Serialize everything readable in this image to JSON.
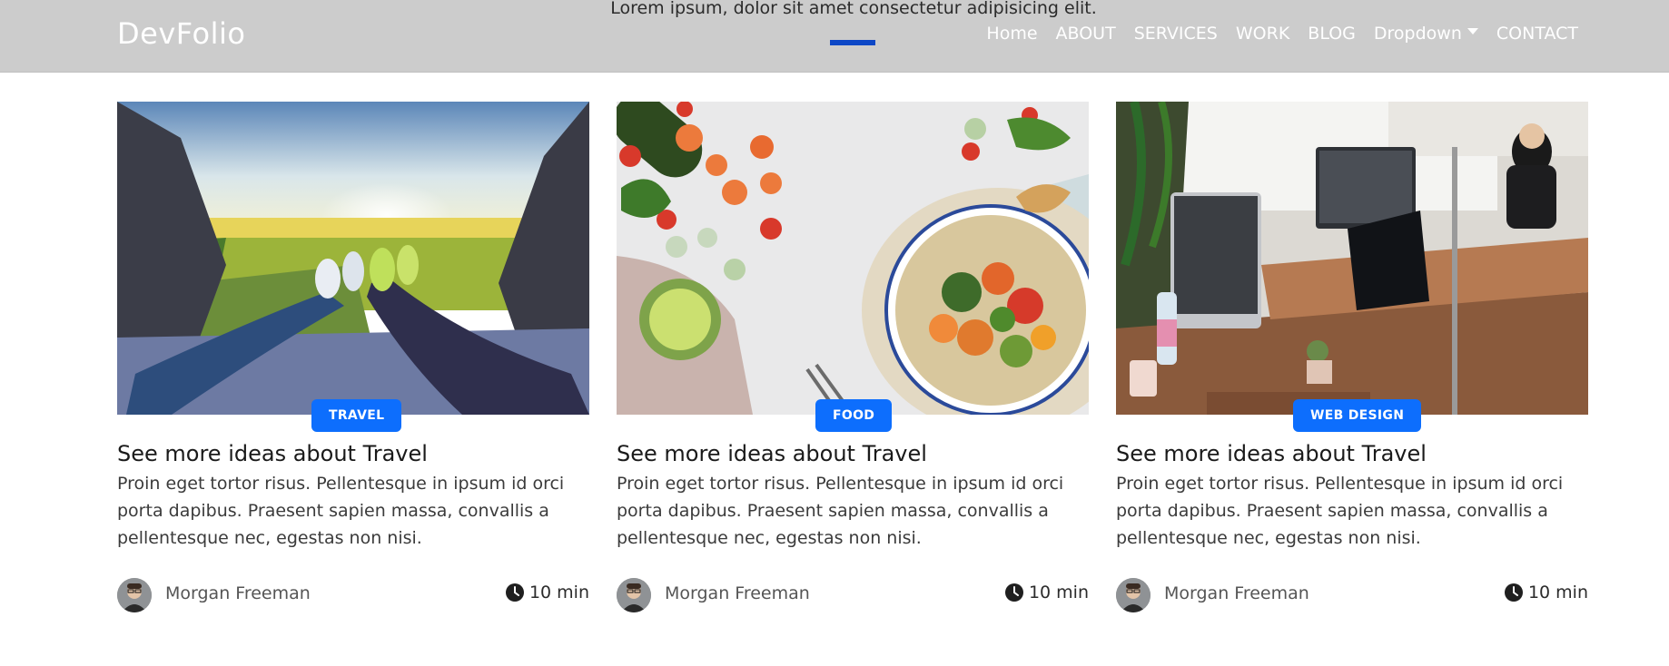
{
  "navbar": {
    "brand": "DevFolio",
    "subtitle": "Lorem ipsum, dolor sit amet consectetur adipisicing elit.",
    "items": [
      {
        "label": "Home"
      },
      {
        "label": "ABOUT"
      },
      {
        "label": "SERVICES"
      },
      {
        "label": "WORK"
      },
      {
        "label": "BLOG"
      },
      {
        "label": "Dropdown"
      },
      {
        "label": "CONTACT"
      }
    ]
  },
  "cards": [
    {
      "image": "travel-photo",
      "category": "TRAVEL",
      "title": "See more ideas about Travel",
      "description": "Proin eget tortor risus. Pellentesque in ipsum id orci porta dapibus. Praesent sapien massa, convallis a pellentesque nec, egestas non nisi.",
      "author": "Morgan Freeman",
      "read_time": "10 min"
    },
    {
      "image": "food-photo",
      "category": "FOOD",
      "title": "See more ideas about Travel",
      "description": "Proin eget tortor risus. Pellentesque in ipsum id orci porta dapibus. Praesent sapien massa, convallis a pellentesque nec, egestas non nisi.",
      "author": "Morgan Freeman",
      "read_time": "10 min"
    },
    {
      "image": "office-photo",
      "category": "WEB DESIGN",
      "title": "See more ideas about Travel",
      "description": "Proin eget tortor risus. Pellentesque in ipsum id orci porta dapibus. Praesent sapien massa, convallis a pellentesque nec, egestas non nisi.",
      "author": "Morgan Freeman",
      "read_time": "10 min"
    }
  ],
  "colors": {
    "navbar_bg": "#cccccc",
    "accent": "#0d6efd",
    "nav_underline": "#0d47c6"
  }
}
